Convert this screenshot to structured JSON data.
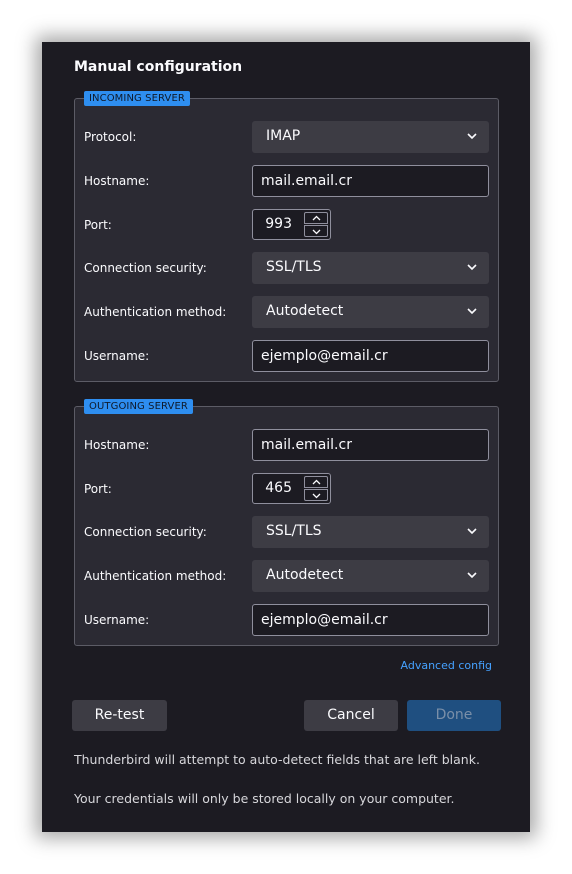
{
  "dialog": {
    "title": "Manual configuration"
  },
  "incoming": {
    "legend": "INCOMING SERVER",
    "protocol_label": "Protocol:",
    "protocol_value": "IMAP",
    "hostname_label": "Hostname:",
    "hostname_value": "mail.email.cr",
    "port_label": "Port:",
    "port_value": "993",
    "security_label": "Connection security:",
    "security_value": "SSL/TLS",
    "auth_label": "Authentication method:",
    "auth_value": "Autodetect",
    "username_label": "Username:",
    "username_value": "ejemplo@email.cr"
  },
  "outgoing": {
    "legend": "OUTGOING SERVER",
    "hostname_label": "Hostname:",
    "hostname_value": "mail.email.cr",
    "port_label": "Port:",
    "port_value": "465",
    "security_label": "Connection security:",
    "security_value": "SSL/TLS",
    "auth_label": "Authentication method:",
    "auth_value": "Autodetect",
    "username_label": "Username:",
    "username_value": "ejemplo@email.cr"
  },
  "actions": {
    "advanced_link": "Advanced config",
    "retest_label": "Re-test",
    "cancel_label": "Cancel",
    "done_label": "Done"
  },
  "notes": {
    "autodetect": "Thunderbird will attempt to auto-detect fields that are left blank.",
    "credentials": "Your credentials will only be stored locally on your computer."
  },
  "colors": {
    "background": "#1c1b22",
    "fieldset": "#2b2a33",
    "accent": "#2e8ef0",
    "link": "#45a1ff",
    "done_disabled": "#1f4f80"
  },
  "icons": {
    "dropdown": "chevron-down-icon",
    "spin_up": "chevron-up-icon",
    "spin_down": "chevron-down-icon"
  }
}
